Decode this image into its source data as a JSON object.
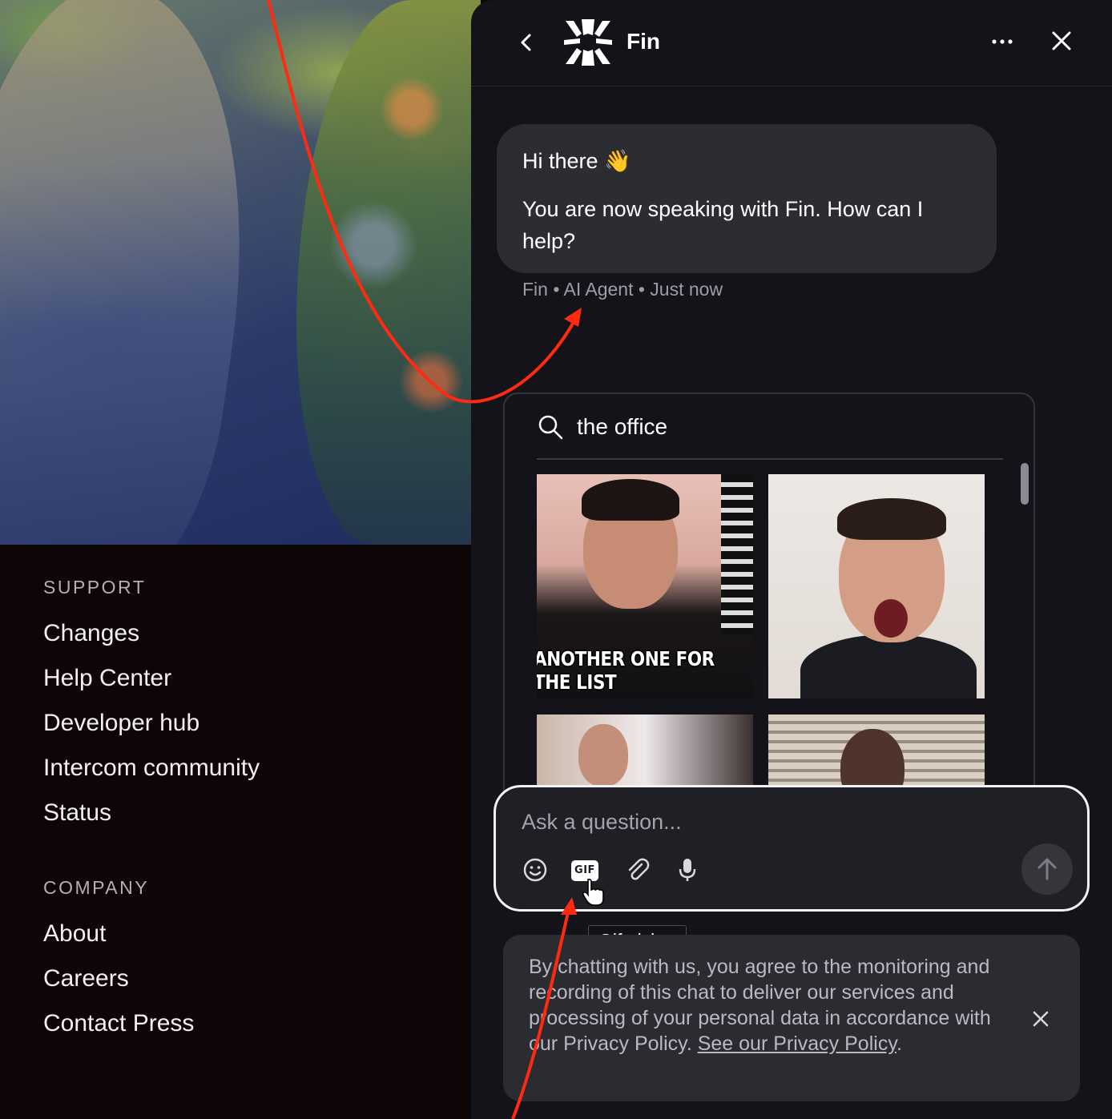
{
  "footer": {
    "support_heading": "SUPPORT",
    "support_links": [
      "Changes",
      "Help Center",
      "Developer hub",
      "Intercom community",
      "Status"
    ],
    "company_heading": "COMPANY",
    "company_links": [
      "About",
      "Careers",
      "Contact Press"
    ]
  },
  "header": {
    "title": "Fin"
  },
  "message": {
    "greeting": "Hi there 👋",
    "body": "You are now speaking with Fin. How can I help?",
    "meta": "Fin • AI Agent • Just now"
  },
  "gif_picker": {
    "search_value": "the office",
    "gifs": [
      {
        "caption": "ANOTHER ONE FOR THE LIST"
      },
      {
        "caption": ""
      },
      {
        "caption": ""
      },
      {
        "caption": ""
      }
    ]
  },
  "composer": {
    "placeholder": "Ask a question...",
    "gif_label": "GIF",
    "tooltip": "Gif picker"
  },
  "notice": {
    "text": "By chatting with us, you agree to the monitoring and recording of this chat to deliver our services and processing of your personal data in accordance with our Privacy Policy. ",
    "link": "See our Privacy Policy",
    "suffix": "."
  },
  "colors": {
    "panel_bg": "#131319",
    "bubble_bg": "#2c2c33",
    "annotation_arrow": "#ff2a12"
  }
}
